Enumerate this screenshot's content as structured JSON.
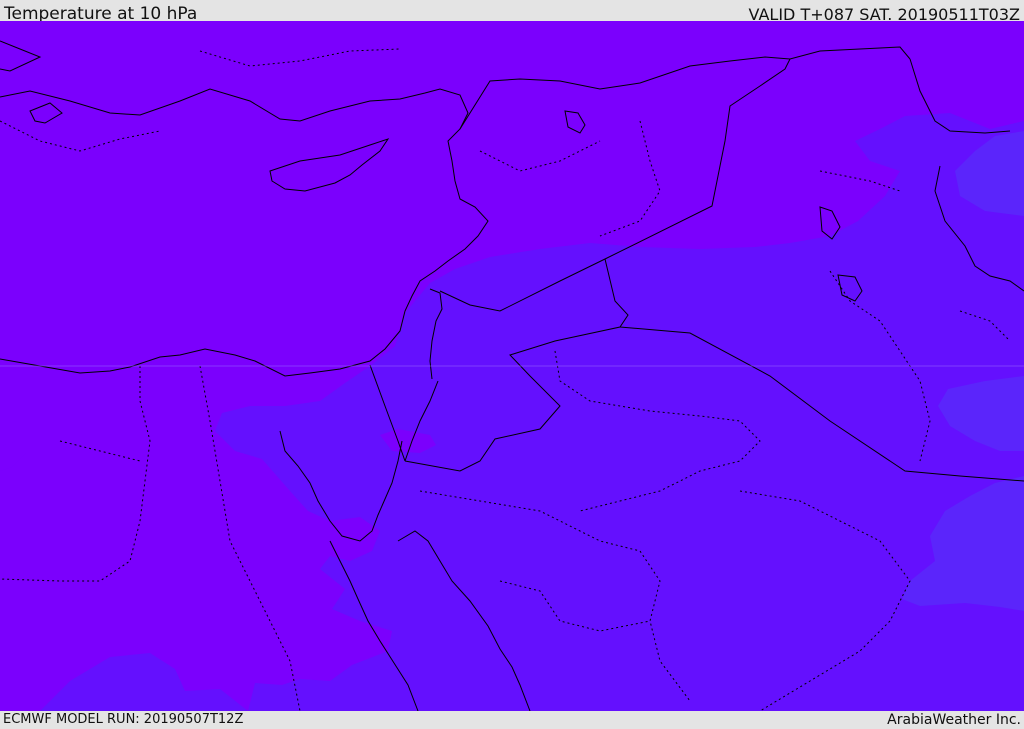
{
  "header": {
    "title": "Temperature at 10 hPa",
    "valid_time": "VALID T+087 SAT. 20190511T03Z"
  },
  "footer": {
    "model_run": "ECMWF MODEL RUN: 20190507T12Z",
    "credit": "ArabiaWeather Inc."
  },
  "map": {
    "field": "Temperature at 10 hPa",
    "colors": {
      "warm_violet": "#7b00fd",
      "mid_indigo": "#6410fe",
      "cool_blue_violet": "#5b25fb",
      "boundary_line": "#000000"
    },
    "region": "Eastern Mediterranean / Levant / Northern Arabia"
  }
}
